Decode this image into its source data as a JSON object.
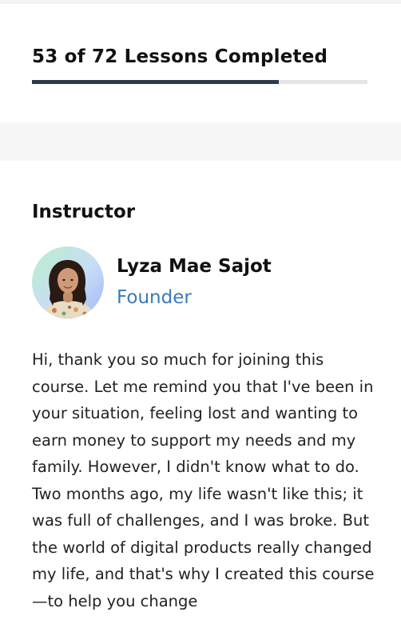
{
  "progress": {
    "completed": 53,
    "total": 72,
    "label": "53 of 72 Lessons Completed",
    "fraction": 0.736
  },
  "instructor": {
    "heading": "Instructor",
    "name": "Lyza Mae Sajot",
    "role": "Founder",
    "bio": "Hi, thank you so much for joining this course. Let me remind you that I've been in your situation, feeling lost and wanting to earn money to support my needs and my family. However, I didn't know what to do. Two months ago, my life wasn't like this; it was full of challenges, and I was broke. But the world of digital products really changed my life, and that's why I created this course—to help you change"
  },
  "colors": {
    "progress_fill": "#2d3a4a",
    "progress_track": "#e4e4e4",
    "role_link": "#3a7bb8"
  }
}
